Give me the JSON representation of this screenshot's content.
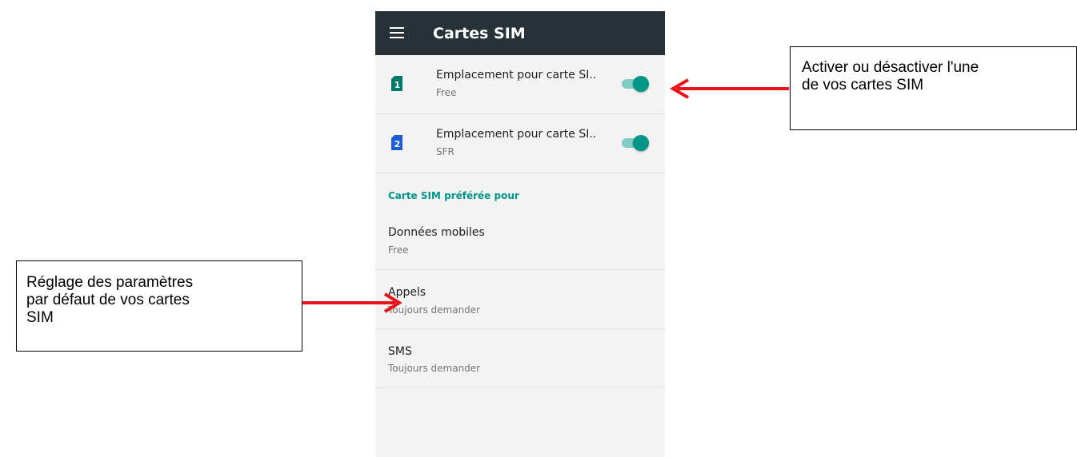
{
  "appbar": {
    "title": "Cartes SIM",
    "menu_icon": "hamburger-menu-icon",
    "background_color": "#263238"
  },
  "sims": [
    {
      "slot_number": "1",
      "title": "Emplacement pour carte SI..",
      "operator": "Free",
      "icon_color": "#00796b",
      "enabled": true
    },
    {
      "slot_number": "2",
      "title": "Emplacement pour carte SI..",
      "operator": "SFR",
      "icon_color": "#1e5bd6",
      "enabled": true
    }
  ],
  "preferred": {
    "header": "Carte SIM préférée pour",
    "items": [
      {
        "title": "Données mobiles",
        "value": "Free"
      },
      {
        "title": "Appels",
        "value": "Toujours demander"
      },
      {
        "title": "SMS",
        "value": "Toujours demander"
      }
    ]
  },
  "callouts": {
    "right": {
      "lines": [
        "Activer ou désactiver l'une",
        "de vos cartes SIM"
      ]
    },
    "left": {
      "lines": [
        "Réglage des paramètres",
        "par défaut de vos cartes",
        "SIM"
      ]
    }
  },
  "colors": {
    "accent": "#009688",
    "arrow": "#e8131b"
  }
}
